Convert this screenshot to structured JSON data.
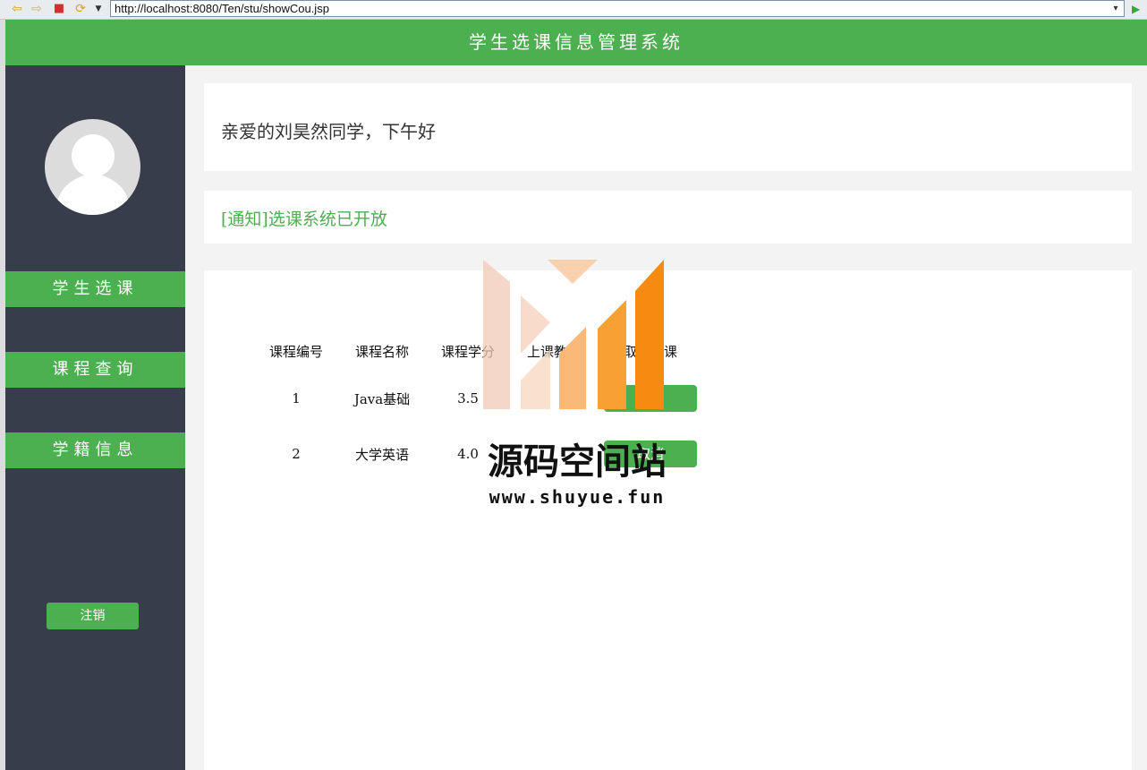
{
  "browser": {
    "url": "http://localhost:8080/Ten/stu/showCou.jsp"
  },
  "header": {
    "title": "学生选课信息管理系统"
  },
  "sidebar": {
    "items": [
      {
        "label": "学生选课"
      },
      {
        "label": "课程查询"
      },
      {
        "label": "学籍信息"
      }
    ],
    "logout_label": "注销"
  },
  "main": {
    "greeting": "亲爱的刘昊然同学，下午好",
    "notice": "[通知]选课系统已开放",
    "table": {
      "headers": [
        "课程编号",
        "课程名称",
        "课程学分",
        "上课教室",
        "取消选课"
      ],
      "rows": [
        {
          "id": "1",
          "name": "Java基础",
          "credit": "3.5",
          "room": "",
          "action": "取消"
        },
        {
          "id": "2",
          "name": "大学英语",
          "credit": "4.0",
          "room": "",
          "action": "取消"
        }
      ]
    }
  },
  "watermark": {
    "text": "源码空间站",
    "url": "www.shuyue.fun"
  },
  "colors": {
    "accent": "#4caf50",
    "sidebar_bg": "#383d4b"
  }
}
